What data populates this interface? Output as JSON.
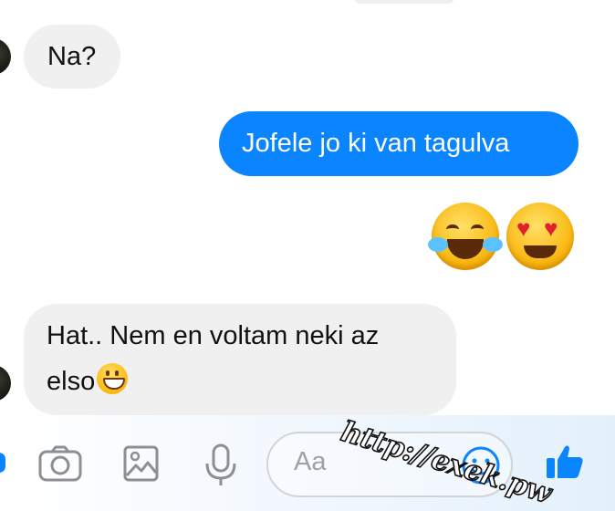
{
  "messages": [
    {
      "direction": "incoming",
      "text": "Na?"
    },
    {
      "direction": "outgoing",
      "text": "Jofele jo ki van tagulva"
    },
    {
      "direction": "outgoing",
      "emojis": [
        "face-with-tears-of-joy",
        "smiling-face-with-heart-eyes"
      ]
    },
    {
      "direction": "incoming",
      "line1": "Hat.. Nem en voltam neki az",
      "line2": "elso",
      "emoji": "grinning-face"
    }
  ],
  "composer": {
    "placeholder": "Aa",
    "icons": [
      "camera-icon",
      "gallery-icon",
      "microphone-icon",
      "emoji-icon",
      "thumbs-up-icon"
    ]
  },
  "watermark": "http://exek.pw",
  "colors": {
    "outgoing_bubble": "#0a84ff",
    "incoming_bubble": "#f0f0f0",
    "accent": "#0a84ff"
  }
}
